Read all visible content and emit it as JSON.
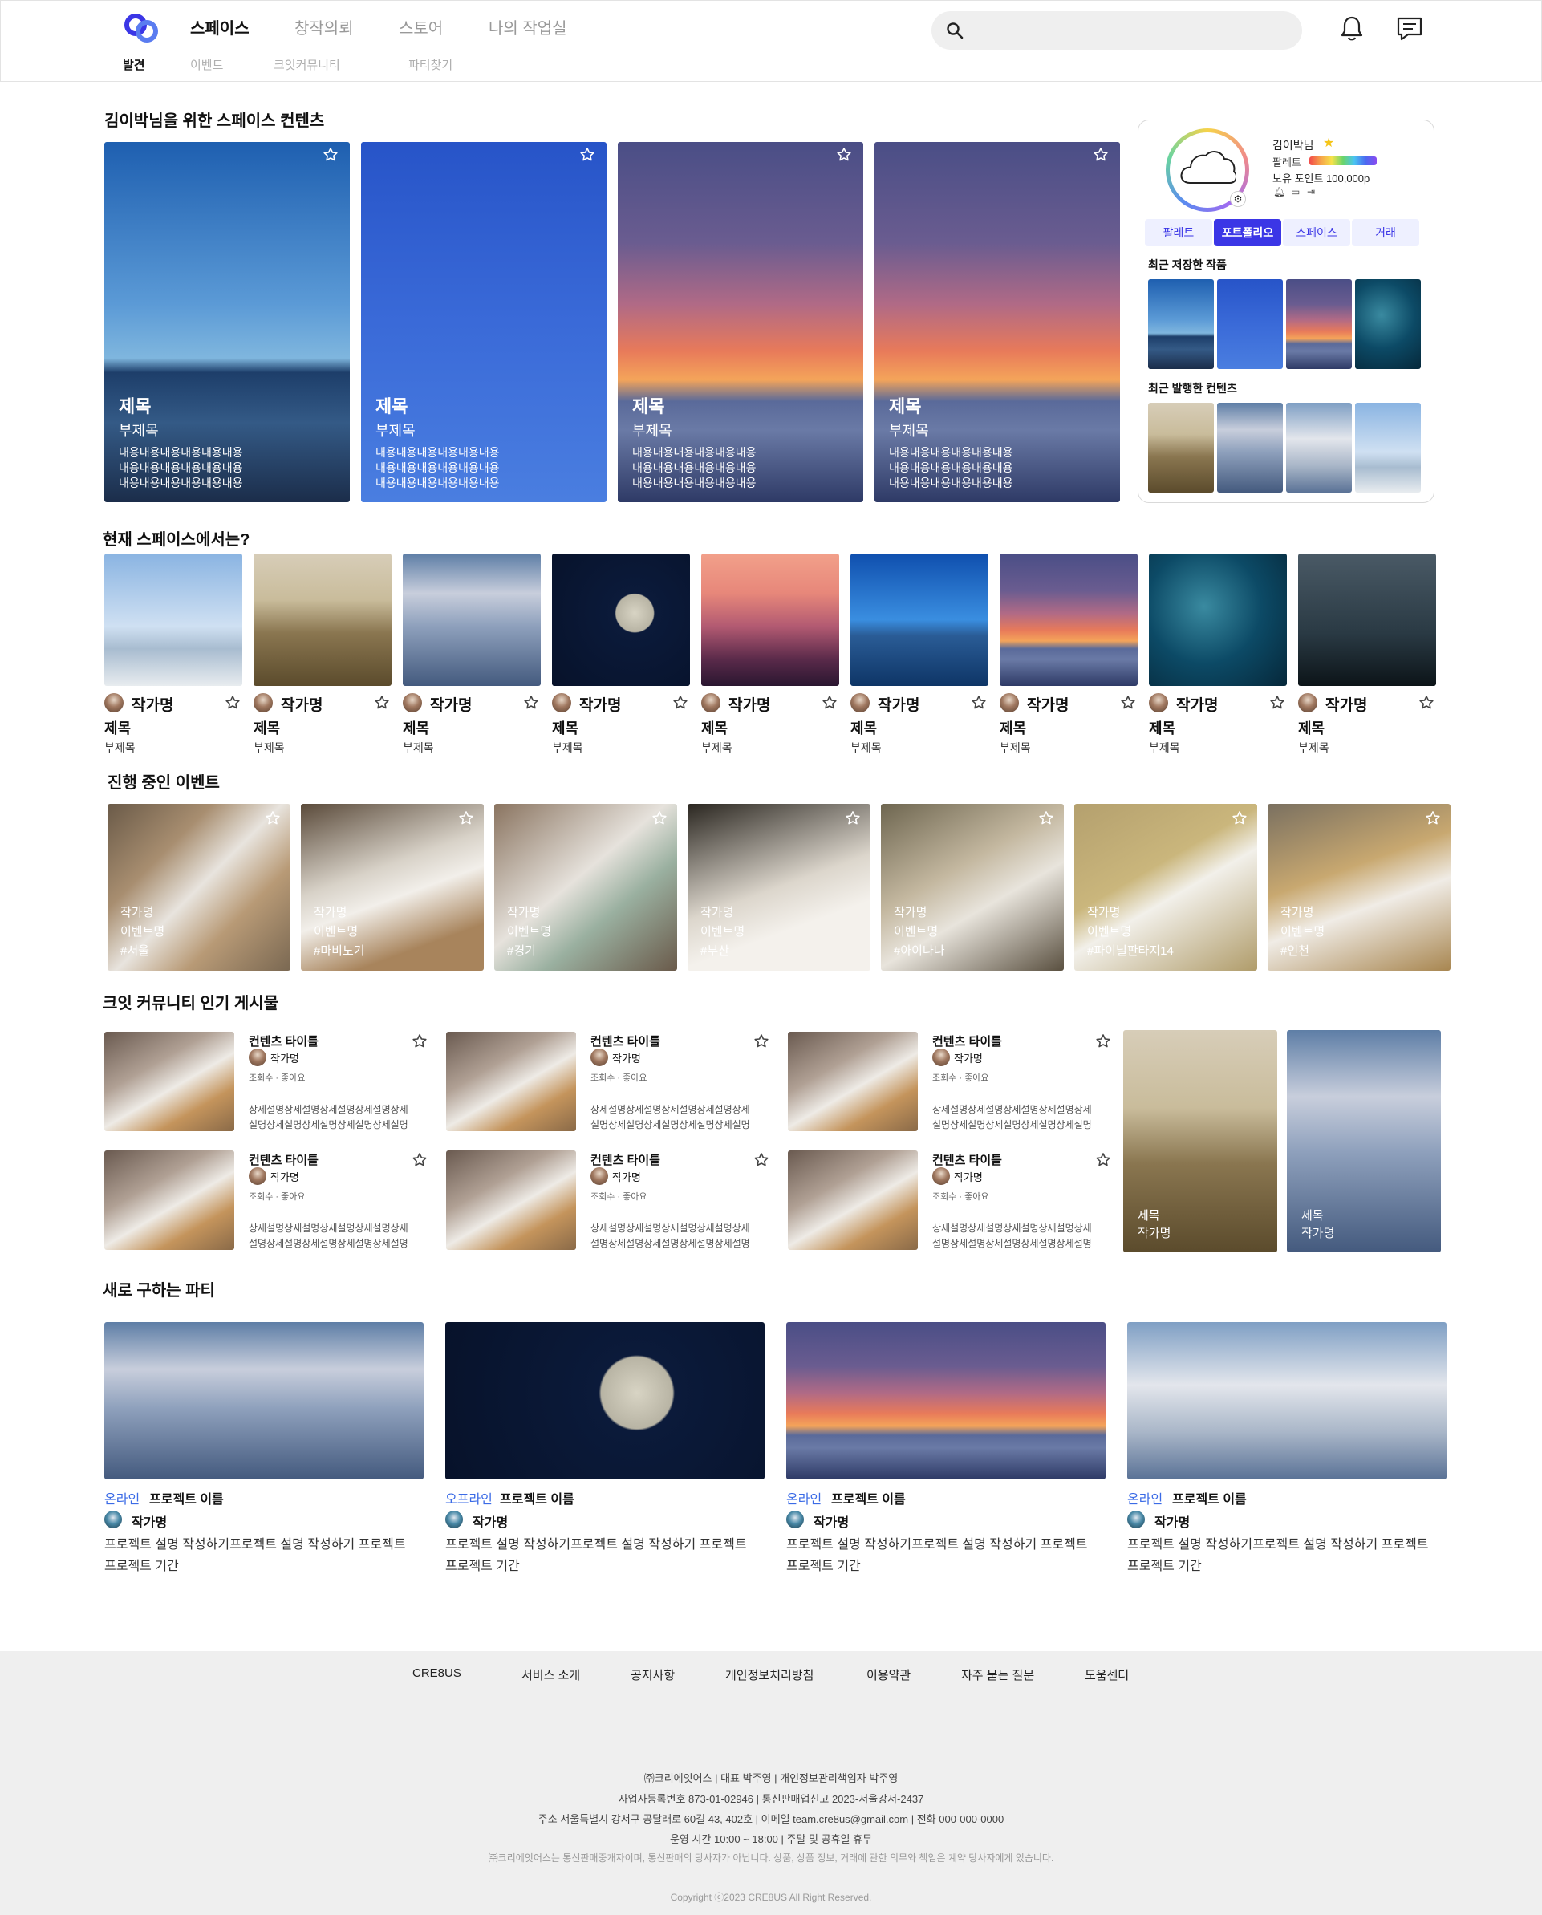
{
  "header": {
    "nav": [
      {
        "label": "스페이스",
        "active": true
      },
      {
        "label": "창작의뢰",
        "active": false
      },
      {
        "label": "스토어",
        "active": false
      },
      {
        "label": "나의 작업실",
        "active": false
      }
    ],
    "subnav": [
      {
        "label": "발견",
        "active": true
      },
      {
        "label": "이벤트",
        "active": false
      },
      {
        "label": "크잇커뮤니티",
        "active": false
      },
      {
        "label": "파티찾기",
        "active": false
      }
    ],
    "search_placeholder": "",
    "icons": [
      "logo-icon",
      "search-icon",
      "bell-icon",
      "message-icon"
    ]
  },
  "space_contents": {
    "title": "김이박님을 위한 스페이스 컨텐츠",
    "cards": [
      {
        "title": "제목",
        "subtitle": "부제목",
        "body": [
          "내용내용내용내용내용내용",
          "내용내용내용내용내용내용",
          "내용내용내용내용내용내용"
        ],
        "image": "lake-sunrise"
      },
      {
        "title": "제목",
        "subtitle": "부제목",
        "body": [
          "내용내용내용내용내용내용",
          "내용내용내용내용내용내용",
          "내용내용내용내용내용내용"
        ],
        "image": "blue-sky-contrail"
      },
      {
        "title": "제목",
        "subtitle": "부제목",
        "body": [
          "내용내용내용내용내용내용",
          "내용내용내용내용내용내용",
          "내용내용내용내용내용내용"
        ],
        "image": "sunset-field"
      },
      {
        "title": "제목",
        "subtitle": "부제목",
        "body": [
          "내용내용내용내용내용내용",
          "내용내용내용내용내용내용",
          "내용내용내용내용내용내용"
        ],
        "image": "sunset-field"
      }
    ]
  },
  "profile": {
    "name": "김이박님",
    "palette_label": "팔레트",
    "points": "보유 포인트 100,000p",
    "tabs": [
      {
        "label": "팔레트",
        "active": false
      },
      {
        "label": "포트폴리오",
        "active": true
      },
      {
        "label": "스페이스",
        "active": false
      },
      {
        "label": "거래",
        "active": false
      }
    ],
    "saved_title": "최근 저장한 작품",
    "published_title": "최근 발행한 컨텐츠"
  },
  "current_space": {
    "title": "현재 스페이스에서는?",
    "items": [
      {
        "author": "작가명",
        "title": "제목",
        "subtitle": "부제목",
        "image": "surf"
      },
      {
        "author": "작가명",
        "title": "제목",
        "subtitle": "부제목",
        "image": "desert"
      },
      {
        "author": "작가명",
        "title": "제목",
        "subtitle": "부제목",
        "image": "clouds"
      },
      {
        "author": "작가명",
        "title": "제목",
        "subtitle": "부제목",
        "image": "moon"
      },
      {
        "author": "작가명",
        "title": "제목",
        "subtitle": "부제목",
        "image": "mountain"
      },
      {
        "author": "작가명",
        "title": "제목",
        "subtitle": "부제목",
        "image": "lake"
      },
      {
        "author": "작가명",
        "title": "제목",
        "subtitle": "부제목",
        "image": "sunset"
      },
      {
        "author": "작가명",
        "title": "제목",
        "subtitle": "부제목",
        "image": "sea"
      },
      {
        "author": "작가명",
        "title": "제목",
        "subtitle": "부제목",
        "image": "night"
      }
    ]
  },
  "events": {
    "title": "진행 중인 이벤트",
    "items": [
      {
        "author": "작가명",
        "event": "이벤트명",
        "tag": "#서울"
      },
      {
        "author": "작가명",
        "event": "이벤트명",
        "tag": "#마비노기"
      },
      {
        "author": "작가명",
        "event": "이벤트명",
        "tag": "#경기"
      },
      {
        "author": "작가명",
        "event": "이벤트명",
        "tag": "#부산"
      },
      {
        "author": "작가명",
        "event": "이벤트명",
        "tag": "#아이나나"
      },
      {
        "author": "작가명",
        "event": "이벤트명",
        "tag": "#파이널판타지14"
      },
      {
        "author": "작가명",
        "event": "이벤트명",
        "tag": "#인천"
      }
    ]
  },
  "community": {
    "title": "크잇 커뮤니티 인기 게시물",
    "posts": [
      {
        "title": "컨텐츠 타이틀",
        "author": "작가명",
        "meta": "조회수 · 좋아요",
        "desc": [
          "상세설명상세설명상세설명상세설명상세",
          "설명상세설명상세설명상세설명상세설명"
        ]
      },
      {
        "title": "컨텐츠 타이틀",
        "author": "작가명",
        "meta": "조회수 · 좋아요",
        "desc": [
          "상세설명상세설명상세설명상세설명상세",
          "설명상세설명상세설명상세설명상세설명"
        ]
      },
      {
        "title": "컨텐츠 타이틀",
        "author": "작가명",
        "meta": "조회수 · 좋아요",
        "desc": [
          "상세설명상세설명상세설명상세설명상세",
          "설명상세설명상세설명상세설명상세설명"
        ]
      },
      {
        "title": "컨텐츠 타이틀",
        "author": "작가명",
        "meta": "조회수 · 좋아요",
        "desc": [
          "상세설명상세설명상세설명상세설명상세",
          "설명상세설명상세설명상세설명상세설명"
        ]
      },
      {
        "title": "컨텐츠 타이틀",
        "author": "작가명",
        "meta": "조회수 · 좋아요",
        "desc": [
          "상세설명상세설명상세설명상세설명상세",
          "설명상세설명상세설명상세설명상세설명"
        ]
      },
      {
        "title": "컨텐츠 타이틀",
        "author": "작가명",
        "meta": "조회수 · 좋아요",
        "desc": [
          "상세설명상세설명상세설명상세설명상세",
          "설명상세설명상세설명상세설명상세설명"
        ]
      }
    ],
    "featured": [
      {
        "title": "제목",
        "author": "작가명",
        "image": "desert"
      },
      {
        "title": "제목",
        "author": "작가명",
        "image": "clouds"
      }
    ]
  },
  "parties": {
    "title": "새로 구하는 파티",
    "items": [
      {
        "mode": "온라인",
        "name": "프로젝트 이름",
        "author": "작가명",
        "desc": "프로젝트 설명 작성하기프로젝트 설명 작성하기 프로젝트",
        "period": "프로젝트 기간",
        "image": "clouds"
      },
      {
        "mode": "오프라인",
        "name": "프로젝트 이름",
        "author": "작가명",
        "desc": "프로젝트 설명 작성하기프로젝트 설명 작성하기 프로젝트",
        "period": "프로젝트 기간",
        "image": "moon"
      },
      {
        "mode": "온라인",
        "name": "프로젝트 이름",
        "author": "작가명",
        "desc": "프로젝트 설명 작성하기프로젝트 설명 작성하기 프로젝트",
        "period": "프로젝트 기간",
        "image": "sunset"
      },
      {
        "mode": "온라인",
        "name": "프로젝트 이름",
        "author": "작가명",
        "desc": "프로젝트 설명 작성하기프로젝트 설명 작성하기 프로젝트",
        "period": "프로젝트 기간",
        "image": "skyclouds"
      }
    ]
  },
  "footer": {
    "links": [
      "CRE8US",
      "서비스 소개",
      "공지사항",
      "개인정보처리방침",
      "이용약관",
      "자주 묻는 질문",
      "도움센터"
    ],
    "line1": "㈜크리에잇어스 | 대표 박주영 | 개인정보관리책임자 박주영",
    "line2": "사업자등록번호 873-01-02946 | 통신판매업신고 2023-서울강서-2437",
    "line3": "주소 서울특별시 강서구 공달래로 60길 43, 402호 | 이메일 team.cre8us@gmail.com | 전화 000-000-0000",
    "line4": "운영 시간 10:00 ~ 18:00 | 주말 및 공휴일 휴무",
    "line5": "㈜크리에잇어스는 통신판매중개자이며, 통신판매의 당사자가 아닙니다. 상품, 상품 정보, 거래에 관한 의무와 책임은 계약 당사자에게 있습니다.",
    "copyright": "Copyright ⓒ2023 CRE8US All Right Reserved."
  },
  "colors": {
    "accent": "#3b36e6",
    "accent_light": "#eef0ff",
    "online": "#3b6be6"
  }
}
